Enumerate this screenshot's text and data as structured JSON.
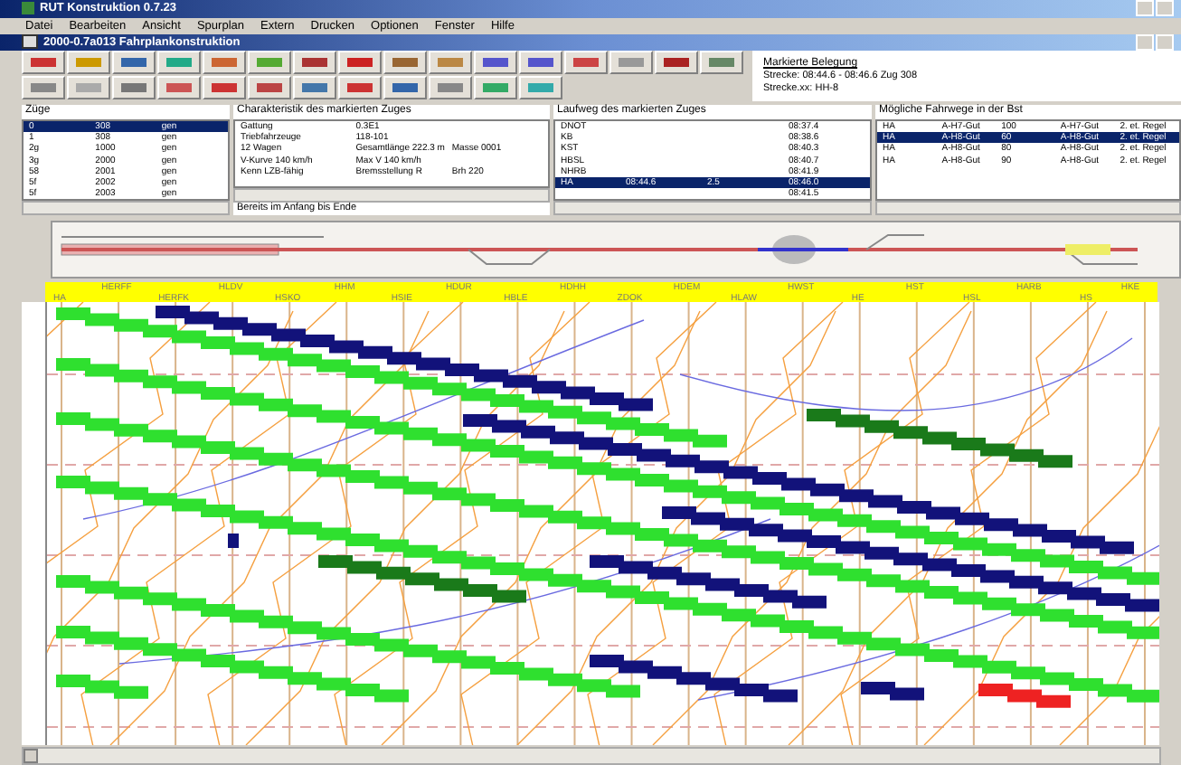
{
  "window": {
    "title": "RUT Konstruktion 0.7.23"
  },
  "menu": [
    "Datei",
    "Bearbeiten",
    "Ansicht",
    "Spurplan",
    "Extern",
    "Drucken",
    "Optionen",
    "Fenster",
    "Hilfe"
  ],
  "document_window": {
    "title": "2000-0.7a013 Fahrplankonstruktion"
  },
  "marked_occupation": {
    "title": "Markierte Belegung",
    "lines": [
      "Strecke: 08:44.6 - 08:46.6 Zug 308",
      "Strecke.xx: HH-8"
    ]
  },
  "trains_panel": {
    "title": "Züge",
    "rows": [
      {
        "cells": [
          "0",
          "308",
          "gen"
        ],
        "selected": true
      },
      {
        "cells": [
          "1",
          "308",
          "gen"
        ],
        "selected": false
      },
      {
        "cells": [
          "2g",
          "1000",
          "gen"
        ],
        "selected": false
      },
      {
        "cells": [
          "3g",
          "2000",
          "gen"
        ],
        "selected": false
      },
      {
        "cells": [
          "58",
          "2001",
          "gen"
        ],
        "selected": false
      },
      {
        "cells": [
          "5f",
          "2002",
          "gen"
        ],
        "selected": false
      },
      {
        "cells": [
          "5f",
          "2003",
          "gen"
        ],
        "selected": false
      }
    ]
  },
  "characteristics_panel": {
    "title": "Charakteristik des markierten Zuges",
    "rows": [
      [
        "Gattung",
        "0.3E1",
        ""
      ],
      [
        "Triebfahrzeuge",
        "118-101",
        ""
      ],
      [
        "12 Wagen",
        "Gesamtlänge 222.3 m",
        "Masse 0001"
      ],
      [
        "V-Kurve 140 km/h",
        "Max V 140 km/h",
        ""
      ],
      [
        "Kenn LZB-fähig",
        "Bremsstellung R",
        "Brh 220"
      ]
    ],
    "footer": "Bereits im Anfang bis Ende"
  },
  "route_panel": {
    "title": "Laufweg des markierten Zuges",
    "rows": [
      {
        "cells": [
          "DNOT",
          "",
          "",
          "08:37.4"
        ],
        "selected": false
      },
      {
        "cells": [
          "KB",
          "",
          "",
          "08:38.6"
        ],
        "selected": false
      },
      {
        "cells": [
          "KST",
          "",
          "",
          "08:40.3"
        ],
        "selected": false
      },
      {
        "cells": [
          "HBSL",
          "",
          "",
          "08:40.7"
        ],
        "selected": false
      },
      {
        "cells": [
          "NHRB",
          "",
          "",
          "08:41.9"
        ],
        "selected": false
      },
      {
        "cells": [
          "HA",
          "08:44.6",
          "2.5",
          "08:46.0"
        ],
        "selected": true
      },
      {
        "cells": [
          "",
          "",
          "",
          "08:41.5"
        ],
        "selected": false
      }
    ]
  },
  "routes_panel": {
    "title": "Mögliche Fahrwege in der Bst",
    "rows": [
      {
        "cells": [
          "HA",
          "A-H7-Gut",
          "100",
          "A-H7-Gut",
          "2. et. Regel"
        ],
        "selected": false
      },
      {
        "cells": [
          "HA",
          "A-H8-Gut",
          "60",
          "A-H8-Gut",
          "2. et. Regel"
        ],
        "selected": true
      },
      {
        "cells": [
          "HA",
          "A-H8-Gut",
          "80",
          "A-H8-Gut",
          "2. et. Regel"
        ],
        "selected": false
      },
      {
        "cells": [
          "HA",
          "A-H8-Gut",
          "90",
          "A-H8-Gut",
          "2. et. Regel"
        ],
        "selected": false
      }
    ]
  },
  "stations": [
    "HA",
    "HERFF",
    "HERFK",
    "HLDV",
    "HSKO",
    "HHM",
    "HSIE",
    "HDUR",
    "HBLE",
    "HDHH",
    "ZDOK",
    "HDEM",
    "HLAW",
    "HWST",
    "HE",
    "HST",
    "HSL",
    "HARB",
    "HS",
    "HKE"
  ]
}
